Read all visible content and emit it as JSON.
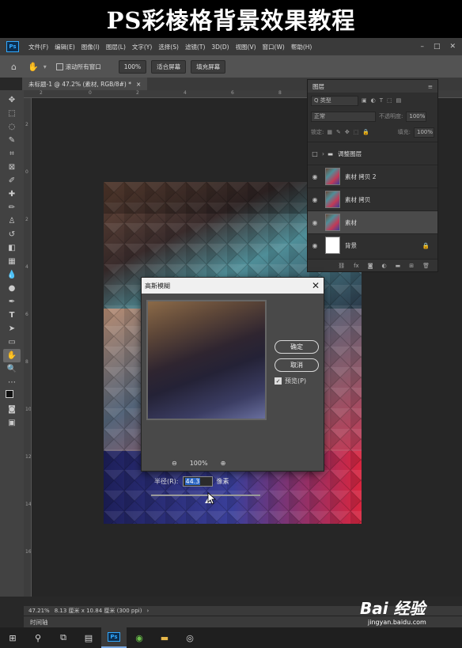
{
  "banner": {
    "title": "PS彩棱格背景效果教程"
  },
  "app": {
    "logo": "Ps",
    "menu": [
      "文件(F)",
      "编辑(E)",
      "图像(I)",
      "图层(L)",
      "文字(Y)",
      "选择(S)",
      "滤镜(T)",
      "3D(D)",
      "视图(V)",
      "窗口(W)",
      "帮助(H)"
    ],
    "window_controls": [
      "–",
      "□",
      "✕"
    ],
    "options": {
      "scroll_all": "滚动所有窗口",
      "zoom": "100%",
      "fit_screen": "适合屏幕",
      "fill_screen": "填充屏幕"
    },
    "doc_tab": "未标题-1 @ 47.2% (素材, RGB/8#) *",
    "doc_tab_close": "×",
    "status": {
      "zoom": "47.21%",
      "size": "8.13 厘米 x 10.84 厘米 (300 ppi)"
    },
    "timeline": "时间轴",
    "rulers": {
      "top": [
        "2",
        "0",
        "2",
        "4",
        "6",
        "8",
        "10",
        "12",
        "14"
      ],
      "left": [
        "2",
        "0",
        "2",
        "4",
        "6",
        "8",
        "10",
        "12",
        "14",
        "16",
        "18"
      ]
    }
  },
  "layers_panel": {
    "title": "图层",
    "filter": "Q 类型",
    "blend_mode": "正常",
    "opacity_label": "不透明度:",
    "opacity_value": "100%",
    "lock_label": "锁定:",
    "fill_label": "填充:",
    "fill_value": "100%",
    "group": "调整图层",
    "layers": [
      {
        "name": "素材 拷贝 2",
        "selected": false
      },
      {
        "name": "素材 拷贝",
        "selected": false
      },
      {
        "name": "素材",
        "selected": true
      },
      {
        "name": "背景",
        "selected": false,
        "locked": true
      }
    ],
    "footer_icons": [
      "link-icon",
      "fx-icon",
      "mask-icon",
      "adjustment-icon",
      "folder-icon",
      "new-layer-icon",
      "trash-icon"
    ]
  },
  "dialog": {
    "title": "高斯模糊",
    "ok": "确定",
    "cancel": "取消",
    "preview_label": "预览(P)",
    "preview_checked": true,
    "zoom": "100%",
    "radius_label": "半径(R):",
    "radius_value": "44.3",
    "unit": "像素"
  },
  "watermark": {
    "brand": "Bai 经验",
    "url": "jingyan.baidu.com"
  },
  "colors": {
    "ps_blue": "#31a8ff",
    "panel_bg": "#2f2f2f",
    "dialog_bg": "#494949",
    "selection": "#2d67c4"
  }
}
